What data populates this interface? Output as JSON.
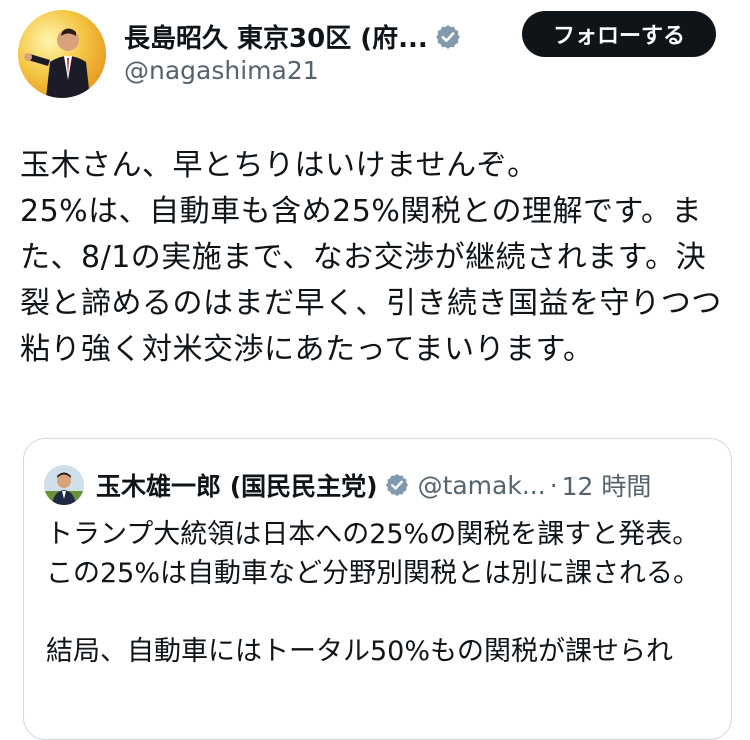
{
  "author": {
    "display_name": "長島昭久 東京30区 (府...",
    "handle": "@nagashima21"
  },
  "follow_button": {
    "label": "フォローする"
  },
  "tweet": {
    "line1": "玉木さん、早とちりはいけませんぞ。",
    "line2": "25%は、自動車も含め25%関税との理解です。また、8/1の実施まで、なお交渉が継続されます。決裂と諦めるのはまだ早く、引き続き国益を守りつつ粘り強く対米交渉にあたってまいります。"
  },
  "quote": {
    "display_name": "玉木雄一郎 (国民民主党)",
    "handle": "@tamak...",
    "separator": "·",
    "time": "12 時間",
    "para1": "トランプ大統領は日本への25%の関税を課すと発表。この25%は自動車など分野別関税とは別に課される。",
    "para2": "結局、自動車にはトータル50%もの関税が課せられ"
  },
  "colors": {
    "verified_badge": "#829aab",
    "follow_bg": "#0f1419",
    "secondary_text": "#536471",
    "card_border": "#cfd9de"
  },
  "icons": {
    "verified": "verified-badge-icon"
  }
}
